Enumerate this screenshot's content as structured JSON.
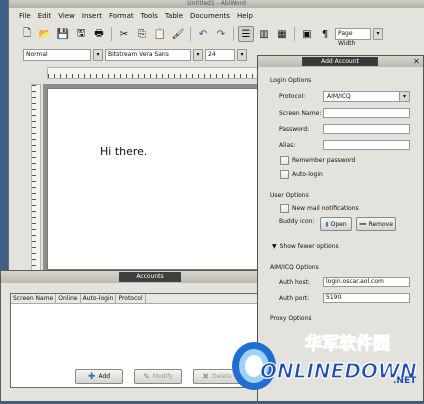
{
  "writer": {
    "title": "Untitled1 - AbiWord",
    "menu": [
      "File",
      "Edit",
      "View",
      "Insert",
      "Format",
      "Tools",
      "Table",
      "Documents",
      "Help"
    ],
    "style_value": "Normal",
    "font_value": "Bitstream Vera Sans",
    "size_value": "24",
    "zoom_value": "Page Width",
    "document_text": "Hi there."
  },
  "accounts": {
    "title": "Accounts",
    "columns": [
      "Screen Name",
      "Online",
      "Auto-login",
      "Protocol"
    ],
    "buttons": {
      "add": "Add",
      "modify": "Modify",
      "delete": "Delete"
    }
  },
  "dialog": {
    "title": "Add Account",
    "login_options": "Login Options",
    "protocol_label": "Protocol:",
    "protocol_value": "AIM/ICQ",
    "screen_name_label": "Screen Name:",
    "password_label": "Password:",
    "alias_label": "Alias:",
    "remember_password": "Remember password",
    "auto_login": "Auto-login",
    "user_options": "User Options",
    "new_mail": "New mail notifications",
    "buddy_icon_label": "Buddy icon:",
    "open_button": "Open",
    "remove_button": "Remove",
    "show_fewer": "Show fewer options",
    "aim_options": "AIM/ICQ Options",
    "auth_host_label": "Auth host:",
    "auth_host_value": "login.oscar.aol.com",
    "auth_port_label": "Auth port:",
    "auth_port_value": "5190",
    "proxy_options": "Proxy Options"
  },
  "watermark": {
    "chinese": "华军软件园",
    "brand": "ONLINEDOWN",
    "suffix": ".NET"
  }
}
